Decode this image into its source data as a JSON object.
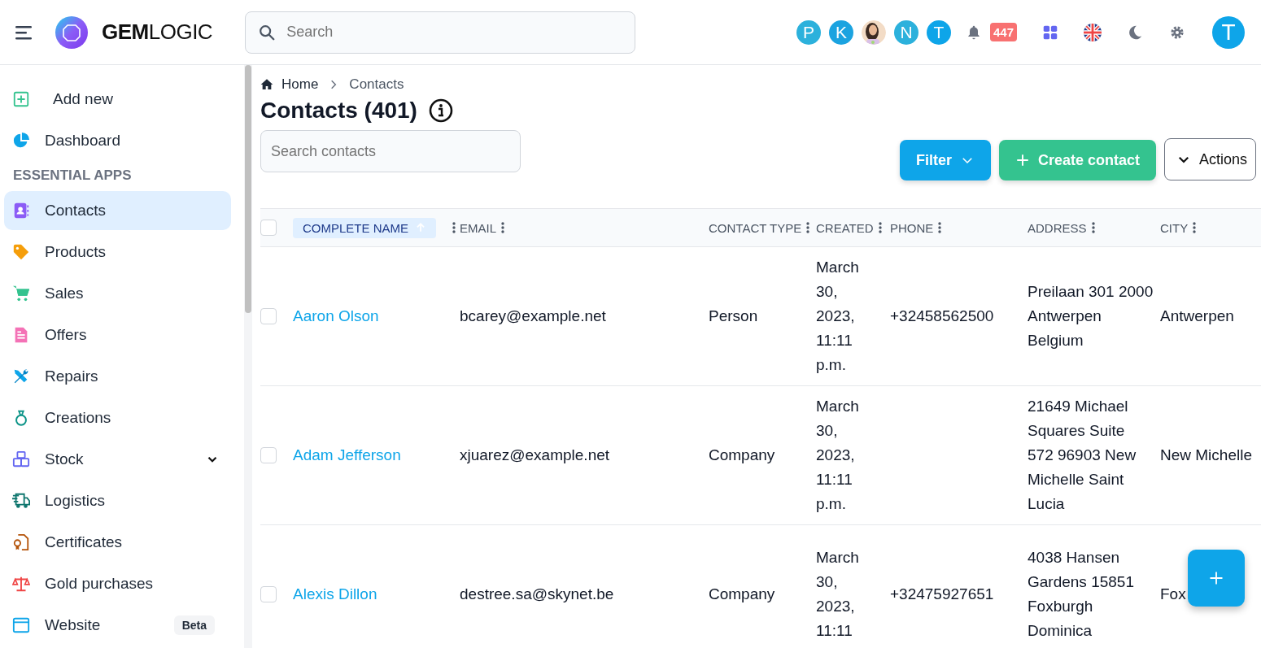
{
  "header": {
    "logo": "**GEM**LOGIC",
    "search": {
      "placeholder": "Search"
    },
    "avatars": [
      {
        "kind": "letter",
        "letter": "P",
        "color": "#2cb1dc"
      },
      {
        "kind": "letter",
        "letter": "K",
        "color": "#1ba3e0"
      },
      {
        "kind": "picture"
      },
      {
        "kind": "letter",
        "letter": "N",
        "color": "#2cb1dc"
      },
      {
        "kind": "letter",
        "letter": "T",
        "color": "#0ea5e9"
      }
    ],
    "notification_count": "447",
    "user_initial": "T"
  },
  "sidebar": {
    "items": [
      {
        "kind": "action",
        "label": "Add new"
      },
      {
        "kind": "item",
        "label": "Dashboard",
        "selected": false
      },
      {
        "kind": "section",
        "label": "ESSENTIAL APPS"
      },
      {
        "kind": "item",
        "label": "Contacts",
        "selected": true
      },
      {
        "kind": "item",
        "label": "Products",
        "selected": false
      },
      {
        "kind": "item",
        "label": "Sales",
        "selected": false
      },
      {
        "kind": "item",
        "label": "Offers",
        "selected": false
      },
      {
        "kind": "item",
        "label": "Repairs",
        "selected": false
      },
      {
        "kind": "item",
        "label": "Creations",
        "selected": false
      },
      {
        "kind": "item",
        "label": "Stock",
        "selected": false,
        "expanded": false
      },
      {
        "kind": "item",
        "label": "Logistics",
        "selected": false
      },
      {
        "kind": "item",
        "label": "Certificates",
        "selected": false
      },
      {
        "kind": "item",
        "label": "Gold purchases",
        "selected": false
      },
      {
        "kind": "item",
        "label": "Website",
        "selected": false,
        "badge": "Beta"
      }
    ]
  },
  "breadcrumb": [
    "Home",
    "Contacts"
  ],
  "page_title": "Contacts (401)",
  "search_contacts": {
    "placeholder": "Search contacts"
  },
  "buttons": [
    {
      "kind": "filter",
      "label": "Filter"
    },
    {
      "kind": "create",
      "label": "Create contact"
    },
    {
      "kind": "actions",
      "label": "Actions"
    }
  ],
  "table": {
    "all_checked": false,
    "columns": [
      {
        "label": "COMPLETE NAME",
        "sorted": true
      },
      {
        "label": "EMAIL",
        "sorted": false
      },
      {
        "label": "CONTACT TYPE",
        "sorted": false
      },
      {
        "label": "CREATED",
        "sorted": false
      },
      {
        "label": "PHONE",
        "sorted": false
      },
      {
        "label": "ADDRESS",
        "sorted": false
      },
      {
        "label": "CITY",
        "sorted": false
      }
    ],
    "rows": [
      {
        "checked": false,
        "name": "Aaron Olson",
        "email": "bcarey@example.net",
        "type": "Person",
        "created": "March 30, 2023, 11:11 p.m.",
        "phone": "+32458562500",
        "address": "Preilaan 301 2000 Antwerpen Belgium",
        "city": "Antwerpen"
      },
      {
        "checked": false,
        "name": "Adam Jefferson",
        "email": "xjuarez@example.net",
        "type": "Company",
        "created": "March 30, 2023, 11:11 p.m.",
        "address": "21649 Michael Squares Suite 572 96903 New Michelle Saint Lucia",
        "city": "New Michelle"
      },
      {
        "checked": false,
        "name": "Alexis Dillon",
        "email": "destree.sa@skynet.be",
        "type": "Company",
        "created": "March 30, 2023, 11:11",
        "phone": "+32475927651",
        "address": "4038 Hansen Gardens 15851 Foxburgh Dominica",
        "city": "Fox"
      }
    ]
  }
}
